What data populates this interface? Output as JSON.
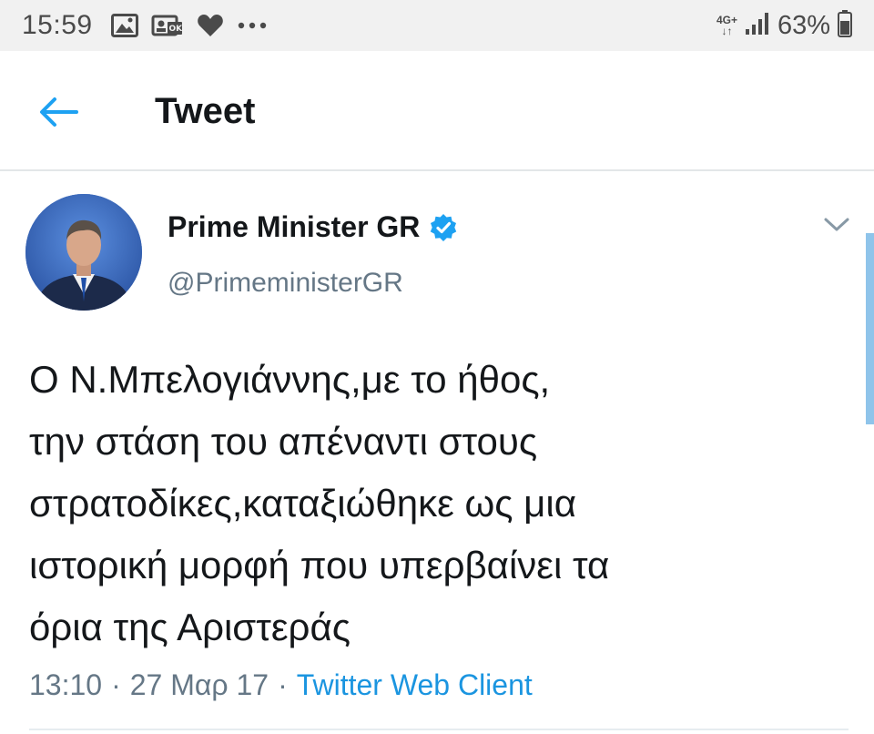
{
  "status_bar": {
    "time": "15:59",
    "left_icons": [
      "image-icon",
      "contact-card-icon",
      "heart-icon",
      "more-dots-icon"
    ],
    "network_type_top": "4G+",
    "network_type_arrows": "↓↑",
    "battery_percent": "63%"
  },
  "header": {
    "title": "Tweet",
    "back_icon": "back-arrow-icon"
  },
  "tweet": {
    "author_name": "Prime Minister GR",
    "verified": true,
    "handle": "@PrimeministerGR",
    "text": "Ο Ν.Μπελογιάννης,με το ήθος,\nτην στάση του απέναντι στους\nστρατοδίκες,καταξιώθηκε ως μια\nιστορική μορφή που υπερβαίνει τα\nόρια της Αριστεράς",
    "time": "13:10",
    "date": "27 Μαρ 17",
    "client": "Twitter Web Client",
    "separator": "·"
  },
  "colors": {
    "accent": "#1da1f2",
    "link": "#1b95e0",
    "secondary_text": "#657786",
    "status_bar_bg": "#f1f1f1"
  }
}
